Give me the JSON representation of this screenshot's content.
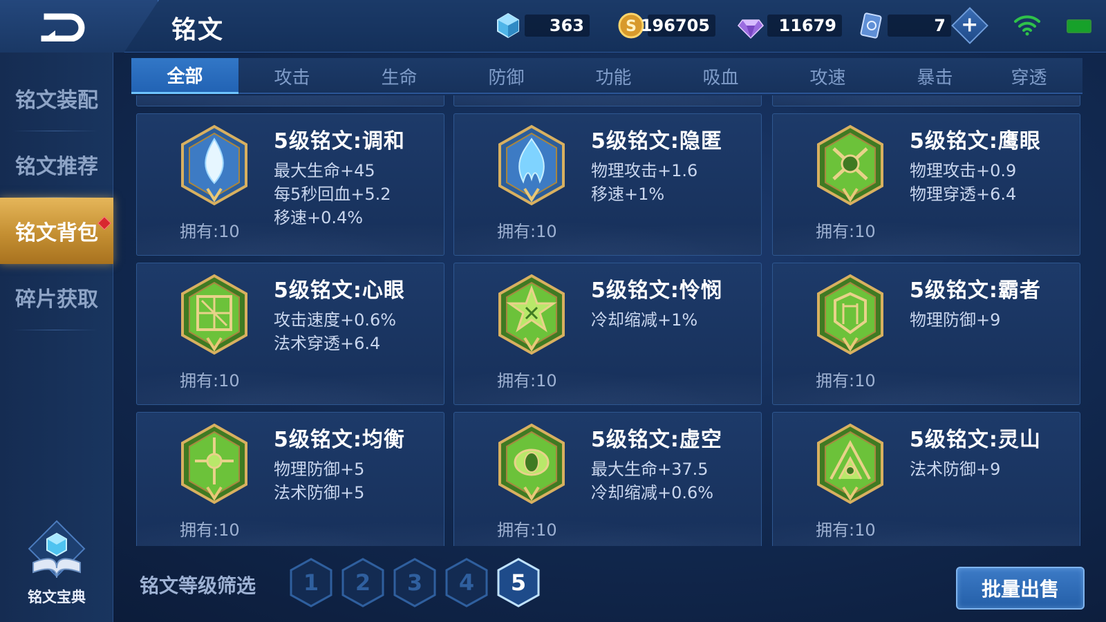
{
  "header": {
    "title": "铭文",
    "currency_blue_crystal": "363",
    "currency_gold": "196705",
    "currency_diamond": "11679",
    "currency_ticket": "7",
    "plus_label": "+"
  },
  "sidebar": {
    "items": [
      {
        "label": "铭文装配"
      },
      {
        "label": "铭文推荐"
      },
      {
        "label": "铭文背包"
      },
      {
        "label": "碎片获取"
      }
    ],
    "active_index": 2,
    "codex_label": "铭文宝典"
  },
  "tabs": {
    "items": [
      "全部",
      "攻击",
      "生命",
      "防御",
      "功能",
      "吸血",
      "攻速",
      "暴击",
      "穿透"
    ],
    "active_index": 0
  },
  "cards": [
    {
      "name": "5级铭文:调和",
      "stats": [
        "最大生命+45",
        "每5秒回血+5.2",
        "移速+0.4%"
      ],
      "owned": "拥有:10",
      "icon": "harmony-emblem-icon",
      "color": "#4a8fd0"
    },
    {
      "name": "5级铭文:隐匿",
      "stats": [
        "物理攻击+1.6",
        "移速+1%"
      ],
      "owned": "拥有:10",
      "icon": "stealth-emblem-icon",
      "color": "#4a8fd0"
    },
    {
      "name": "5级铭文:鹰眼",
      "stats": [
        "物理攻击+0.9",
        "物理穿透+6.4"
      ],
      "owned": "拥有:10",
      "icon": "hawkeye-emblem-icon",
      "color": "#6cc23a"
    },
    {
      "name": "5级铭文:心眼",
      "stats": [
        "攻击速度+0.6%",
        "法术穿透+6.4"
      ],
      "owned": "拥有:10",
      "icon": "mind-eye-emblem-icon",
      "color": "#6cc23a"
    },
    {
      "name": "5级铭文:怜悯",
      "stats": [
        "冷却缩减+1%"
      ],
      "owned": "拥有:10",
      "icon": "mercy-emblem-icon",
      "color": "#6cc23a"
    },
    {
      "name": "5级铭文:霸者",
      "stats": [
        "物理防御+9"
      ],
      "owned": "拥有:10",
      "icon": "overlord-emblem-icon",
      "color": "#6cc23a"
    },
    {
      "name": "5级铭文:均衡",
      "stats": [
        "物理防御+5",
        "法术防御+5"
      ],
      "owned": "拥有:10",
      "icon": "balance-emblem-icon",
      "color": "#6cc23a"
    },
    {
      "name": "5级铭文:虚空",
      "stats": [
        "最大生命+37.5",
        "冷却缩减+0.6%"
      ],
      "owned": "拥有:10",
      "icon": "void-emblem-icon",
      "color": "#6cc23a"
    },
    {
      "name": "5级铭文:灵山",
      "stats": [
        "法术防御+9"
      ],
      "owned": "拥有:10",
      "icon": "spirit-mountain-emblem-icon",
      "color": "#6cc23a"
    }
  ],
  "filter": {
    "label": "铭文等级筛选",
    "levels": [
      "1",
      "2",
      "3",
      "4",
      "5"
    ],
    "active_index": 4
  },
  "bulk_sell_label": "批量出售"
}
